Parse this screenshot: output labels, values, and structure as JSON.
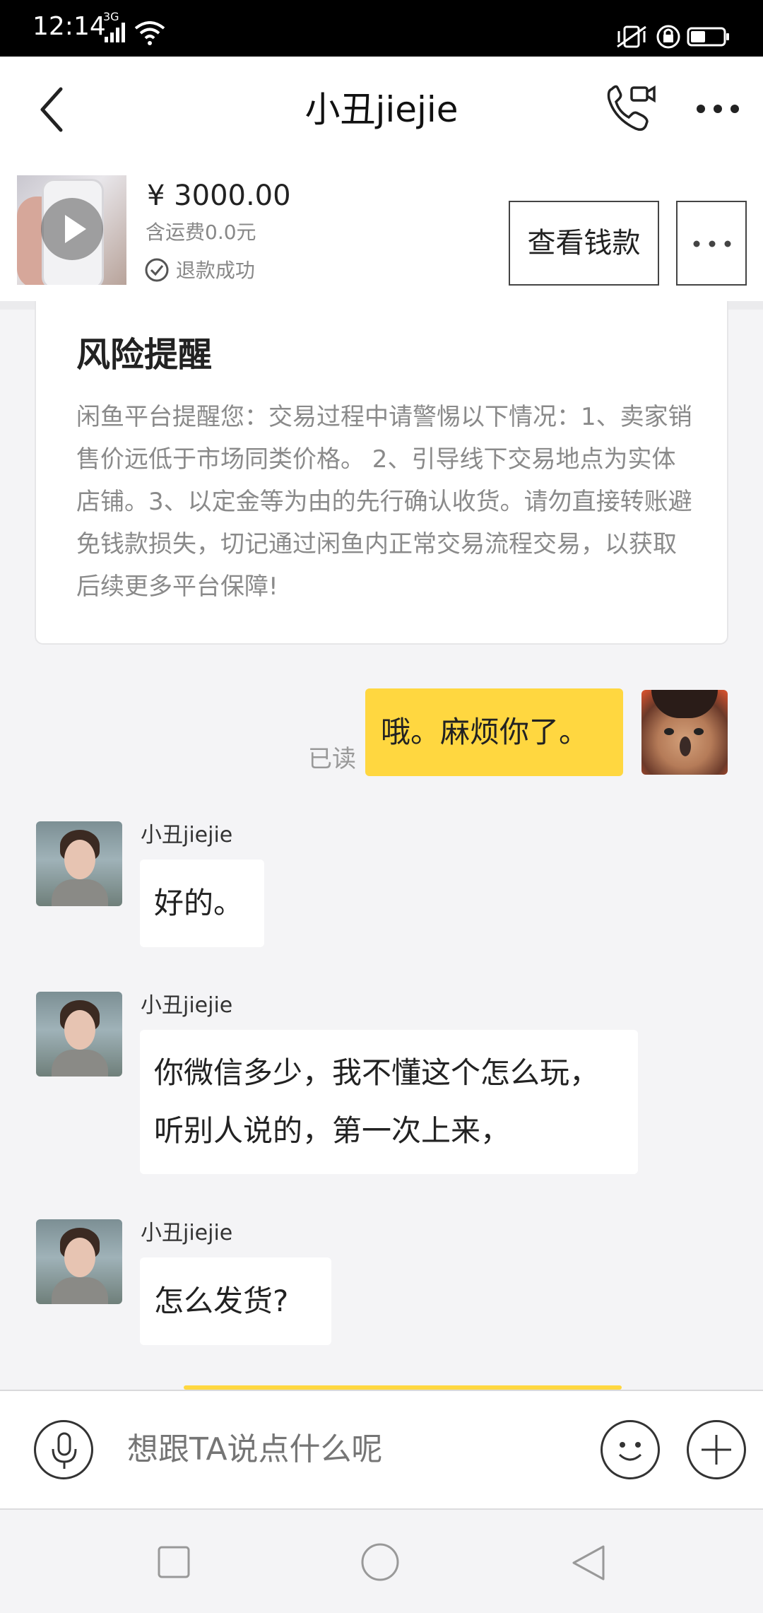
{
  "status_bar": {
    "time": "12:14",
    "network": "3G"
  },
  "header": {
    "title": "小丑jiejie",
    "back_icon": "back-chevron-icon",
    "call_icon": "video-call-icon",
    "more_icon": "more-dots-icon"
  },
  "product": {
    "price": "¥ 3000.00",
    "shipping": "含运费0.0元",
    "status": "退款成功",
    "view_money_label": "查看钱款"
  },
  "risk_notice": {
    "title": "风险提醒",
    "text": "闲鱼平台提醒您：交易过程中请警惕以下情况：1、卖家销售价远低于市场同类价格。 2、引导线下交易地点为实体店铺。3、以定金等为由的先行确认收货。请勿直接转账避免钱款损失，切记通过闲鱼内正常交易流程交易，以获取后续更多平台保障!"
  },
  "messages": [
    {
      "from": "me",
      "text": "哦。麻烦你了。",
      "read_label": "已读"
    },
    {
      "from": "小丑jiejie",
      "text": "好的。"
    },
    {
      "from": "小丑jiejie",
      "text": "你微信多少，我不懂这个怎么玩，听别人说的，第一次上来，"
    },
    {
      "from": "小丑jiejie",
      "text": "怎么发货?"
    }
  ],
  "input_bar": {
    "placeholder": "想跟TA说点什么呢"
  },
  "colors": {
    "accent_yellow": "#ffd740",
    "background": "#f4f4f6"
  }
}
